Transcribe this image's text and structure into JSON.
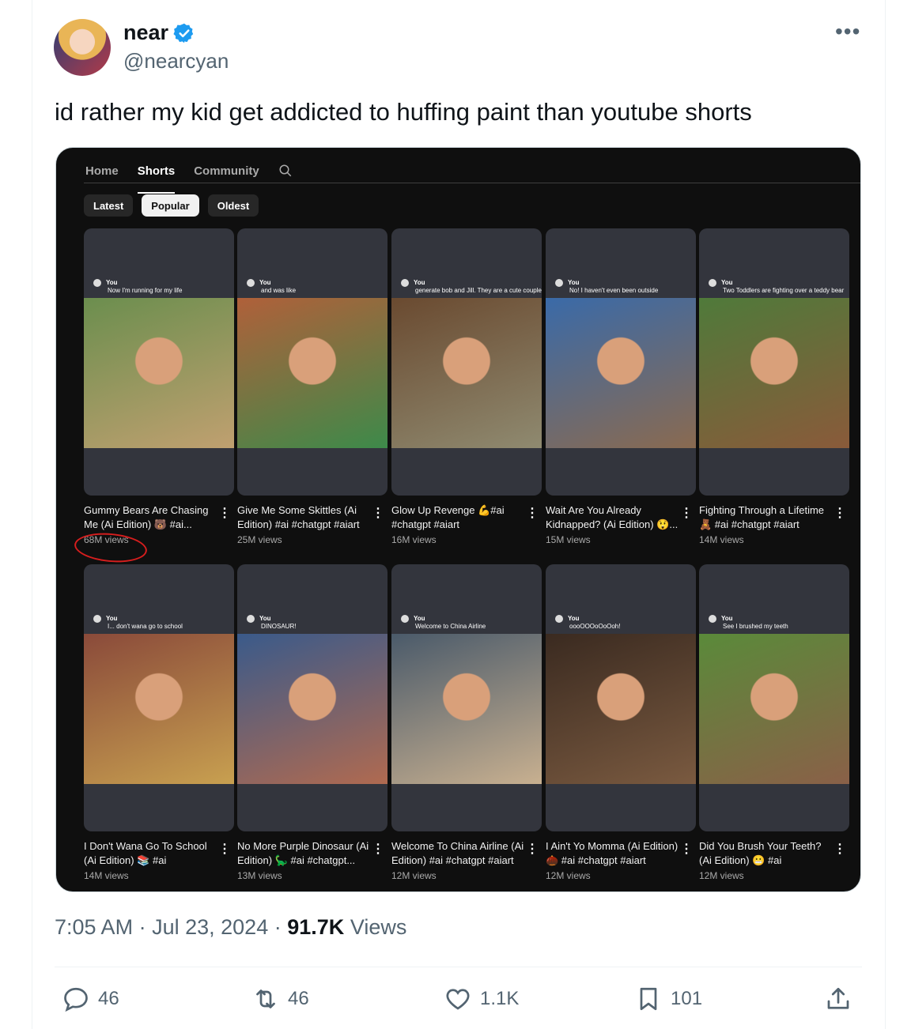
{
  "author": {
    "name": "near",
    "handle": "@nearcyan",
    "verified_icon": "verified-badge-icon",
    "more_label": "•••"
  },
  "tweet": {
    "text": "id rather my kid get addicted to huffing paint than youtube shorts"
  },
  "youtube": {
    "tabs": [
      {
        "label": "Home",
        "active": false
      },
      {
        "label": "Shorts",
        "active": true
      },
      {
        "label": "Community",
        "active": false
      }
    ],
    "chips": [
      {
        "label": "Latest",
        "active": false
      },
      {
        "label": "Popular",
        "active": true
      },
      {
        "label": "Oldest",
        "active": false
      }
    ],
    "shorts": [
      {
        "title": "Gummy Bears Are Chasing Me (Ai Edition) 🐻 #ai...",
        "views": "68M views",
        "cap_user": "You",
        "cap_text": "Now I'm running for my life",
        "circled": true,
        "color_a": "#6b8e4e",
        "color_b": "#c0a070"
      },
      {
        "title": "Give Me Some Skittles (Ai Edition) #ai #chatgpt #aiart",
        "views": "25M views",
        "cap_user": "You",
        "cap_text": "and was like",
        "circled": false,
        "color_a": "#b0603a",
        "color_b": "#3d8a4a"
      },
      {
        "title": "Glow Up Revenge 💪#ai #chatgpt #aiart",
        "views": "16M views",
        "cap_user": "You",
        "cap_text": "generate bob and Jill. They are a cute couple",
        "circled": false,
        "color_a": "#6a4a30",
        "color_b": "#8f8a70"
      },
      {
        "title": "Wait Are You Already Kidnapped? (Ai Edition) 😲...",
        "views": "15M views",
        "cap_user": "You",
        "cap_text": "No! I haven't even been outside",
        "circled": false,
        "color_a": "#3a6aa8",
        "color_b": "#8a6a50"
      },
      {
        "title": "Fighting Through a Lifetime 🧸 #ai #chatgpt #aiart",
        "views": "14M views",
        "cap_user": "You",
        "cap_text": "Two Toddlers are fighting over a teddy bear",
        "circled": false,
        "color_a": "#4f7a3a",
        "color_b": "#8a5a3a"
      },
      {
        "title": "I Don't Wana Go To School (Ai Edition) 📚 #ai #chatgpt...",
        "views": "14M views",
        "cap_user": "You",
        "cap_text": "I... don't wana go to school",
        "circled": false,
        "color_a": "#8a4a3a",
        "color_b": "#c8a050"
      },
      {
        "title": "No More Purple Dinosaur (Ai Edition) 🦕 #ai #chatgpt...",
        "views": "13M views",
        "cap_user": "You",
        "cap_text": "DINOSAUR!",
        "circled": false,
        "color_a": "#3a5a8a",
        "color_b": "#b06a50"
      },
      {
        "title": "Welcome To China Airline (Ai Edition) #ai #chatgpt #aiart",
        "views": "12M views",
        "cap_user": "You",
        "cap_text": "Welcome to China Airline",
        "circled": false,
        "color_a": "#4a5a6a",
        "color_b": "#c8b090"
      },
      {
        "title": "I Ain't Yo Momma (Ai Edition) 🌰 #ai #chatgpt #aiart",
        "views": "12M views",
        "cap_user": "You",
        "cap_text": "oooOOOoOoOoh!",
        "circled": false,
        "color_a": "#3a2a20",
        "color_b": "#7a5a40"
      },
      {
        "title": "Did You Brush Your Teeth? (Ai Edition) 😬 #ai #chatgpt...",
        "views": "12M views",
        "cap_user": "You",
        "cap_text": "See I brushed my teeth",
        "circled": false,
        "color_a": "#5a8a3a",
        "color_b": "#8a6048"
      }
    ]
  },
  "meta": {
    "time": "7:05 AM",
    "dot1": "·",
    "date": "Jul 23, 2024",
    "dot2": "·",
    "views_count": "91.7K",
    "views_label": "Views"
  },
  "actions": {
    "replies": "46",
    "reposts": "46",
    "likes": "1.1K",
    "bookmarks": "101"
  },
  "colors": {
    "accent": "#1d9bf0",
    "muted": "#536471",
    "circle": "#d61e1e"
  }
}
